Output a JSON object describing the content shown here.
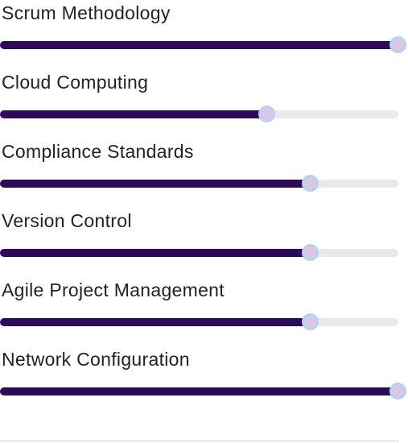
{
  "skills": [
    {
      "label": "Scrum Methodology",
      "level": 1.0
    },
    {
      "label": "Cloud Computing",
      "level": 0.67
    },
    {
      "label": "Compliance Standards",
      "level": 0.78
    },
    {
      "label": "Version Control",
      "level": 0.78
    },
    {
      "label": "Agile Project Management",
      "level": 0.78
    },
    {
      "label": "Network Configuration",
      "level": 1.0
    }
  ],
  "colors": {
    "fill": "#2e0b59",
    "track": "#e9e9ec",
    "thumb_border": "#a7d8ef"
  }
}
